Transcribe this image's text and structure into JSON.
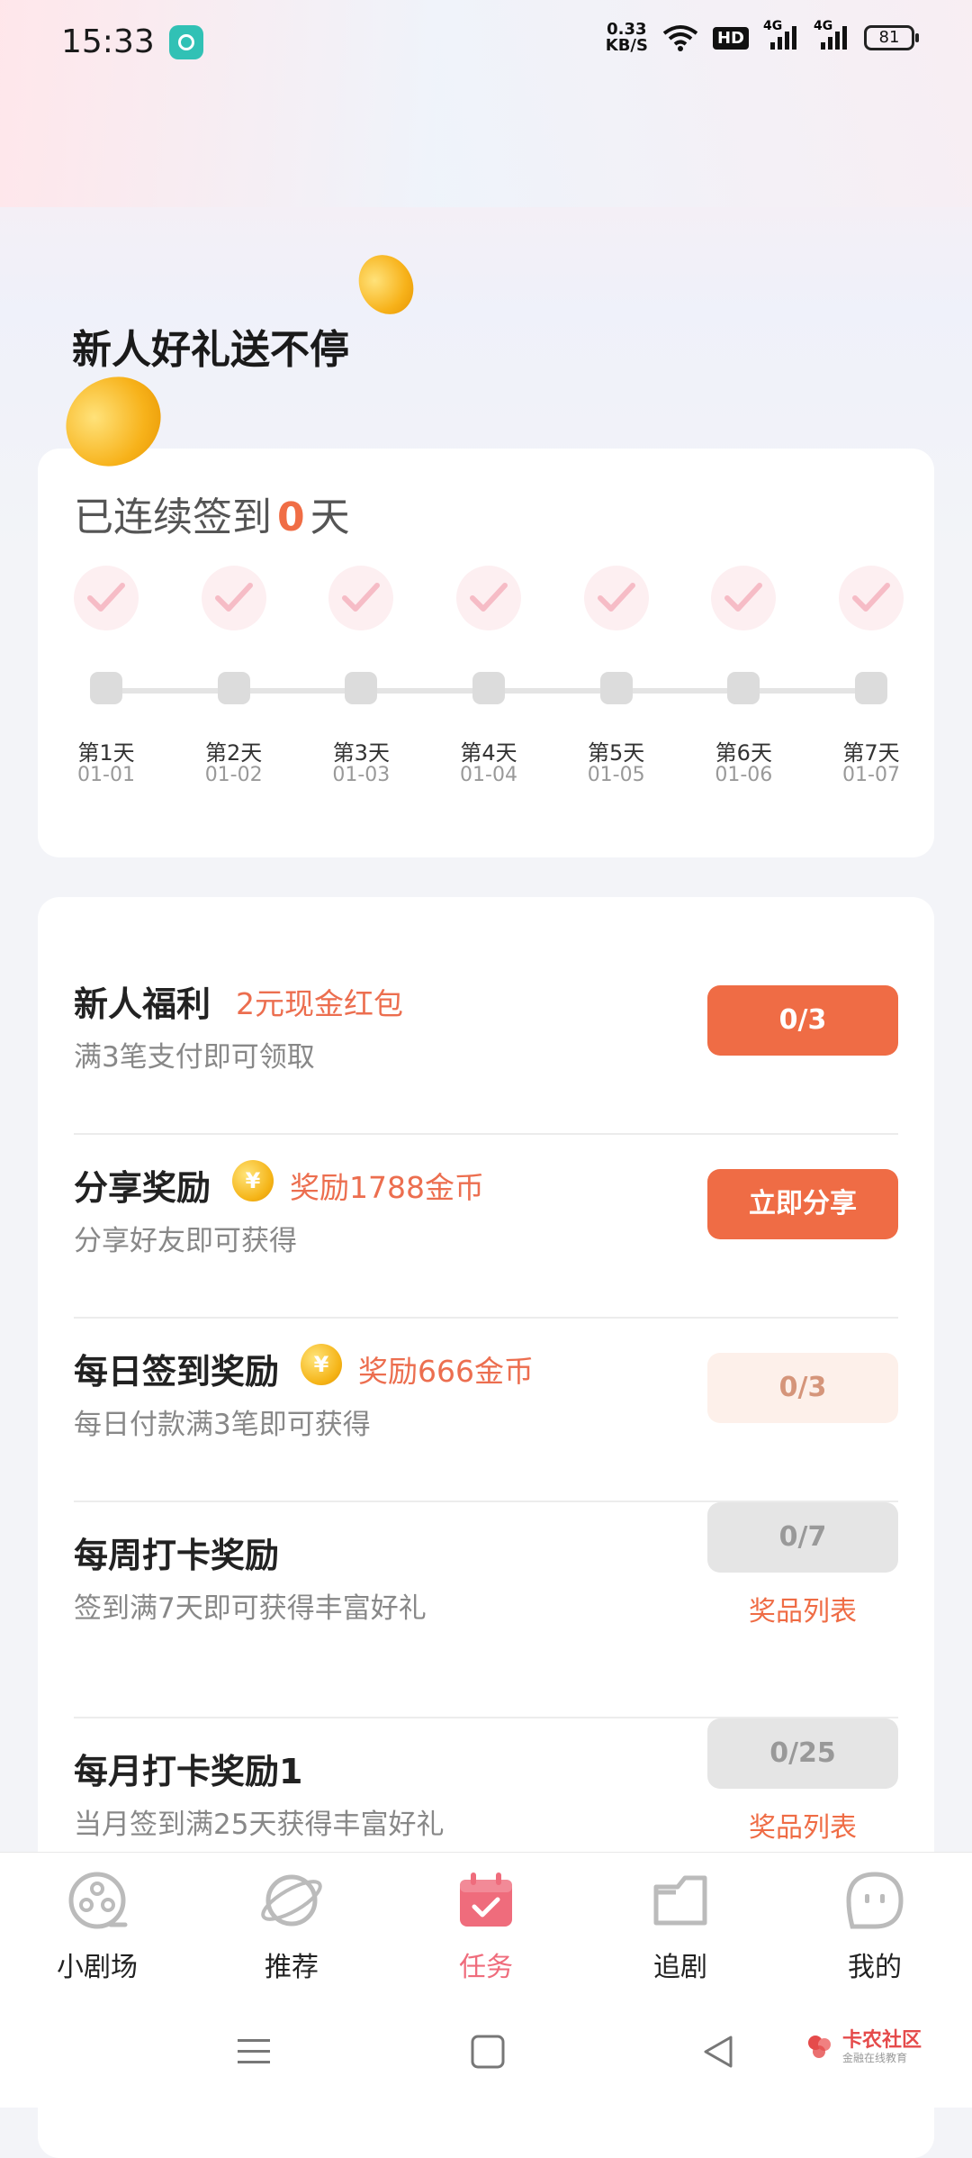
{
  "status_bar": {
    "time": "15:33",
    "net_speed_value": "0.33",
    "net_speed_unit": "KB/S",
    "hd_label": "HD",
    "sig1": "4G",
    "sig2": "4G",
    "battery": "81"
  },
  "hero": {
    "title": "新人好礼送不停"
  },
  "sign_in": {
    "prefix": "已连续签到",
    "count": "0",
    "suffix": "天",
    "days": [
      {
        "label": "第1天",
        "date": "01-01"
      },
      {
        "label": "第2天",
        "date": "01-02"
      },
      {
        "label": "第3天",
        "date": "01-03"
      },
      {
        "label": "第4天",
        "date": "01-04"
      },
      {
        "label": "第5天",
        "date": "01-05"
      },
      {
        "label": "第6天",
        "date": "01-06"
      },
      {
        "label": "第7天",
        "date": "01-07"
      }
    ]
  },
  "tasks": [
    {
      "title": "新人福利",
      "reward": "2元现金红包",
      "desc": "满3笔支付即可领取",
      "button": "0/3"
    },
    {
      "title": "分享奖励",
      "reward": "奖励1788金币",
      "desc": "分享好友即可获得",
      "button": "立即分享"
    },
    {
      "title": "每日签到奖励",
      "reward": "奖励666金币",
      "desc": "每日付款满3笔即可获得",
      "button": "0/3"
    },
    {
      "title": "每周打卡奖励",
      "reward": "",
      "desc": "签到满7天即可获得丰富好礼",
      "button": "0/7",
      "link": "奖品列表"
    },
    {
      "title": "每月打卡奖励1",
      "reward": "",
      "desc": "当月签到满25天获得丰富好礼",
      "button": "0/25",
      "link": "奖品列表"
    }
  ],
  "coin_symbol": "¥",
  "nav": [
    {
      "label": "小剧场",
      "icon": "film-reel-icon"
    },
    {
      "label": "推荐",
      "icon": "planet-icon"
    },
    {
      "label": "任务",
      "icon": "calendar-check-icon",
      "active": true
    },
    {
      "label": "追剧",
      "icon": "folder-icon"
    },
    {
      "label": "我的",
      "icon": "face-icon"
    }
  ],
  "watermark": {
    "title": "卡农社区",
    "subtitle": "金融在线教育"
  },
  "colors": {
    "accent": "#ef6c45",
    "nav_active": "#ef6c7c"
  }
}
